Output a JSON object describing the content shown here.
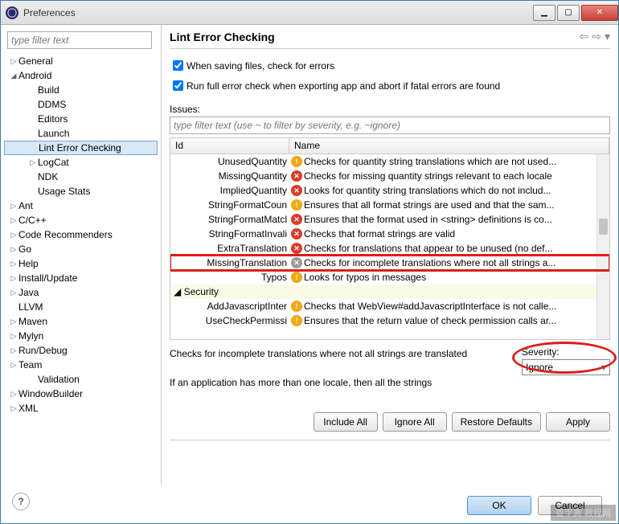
{
  "window": {
    "title": "Preferences"
  },
  "sidebar": {
    "filter_placeholder": "type filter text",
    "items": [
      {
        "label": "General",
        "depth": 1,
        "expand": "▷"
      },
      {
        "label": "Android",
        "depth": 1,
        "expand": "◢"
      },
      {
        "label": "Build",
        "depth": 2,
        "expand": ""
      },
      {
        "label": "DDMS",
        "depth": 2,
        "expand": ""
      },
      {
        "label": "Editors",
        "depth": 2,
        "expand": ""
      },
      {
        "label": "Launch",
        "depth": 2,
        "expand": ""
      },
      {
        "label": "Lint Error Checking",
        "depth": 2,
        "expand": "",
        "selected": true
      },
      {
        "label": "LogCat",
        "depth": 2,
        "expand": "▷"
      },
      {
        "label": "NDK",
        "depth": 2,
        "expand": ""
      },
      {
        "label": "Usage Stats",
        "depth": 2,
        "expand": ""
      },
      {
        "label": "Ant",
        "depth": 1,
        "expand": "▷"
      },
      {
        "label": "C/C++",
        "depth": 1,
        "expand": "▷"
      },
      {
        "label": "Code Recommenders",
        "depth": 1,
        "expand": "▷"
      },
      {
        "label": "Go",
        "depth": 1,
        "expand": "▷"
      },
      {
        "label": "Help",
        "depth": 1,
        "expand": "▷"
      },
      {
        "label": "Install/Update",
        "depth": 1,
        "expand": "▷"
      },
      {
        "label": "Java",
        "depth": 1,
        "expand": "▷"
      },
      {
        "label": "LLVM",
        "depth": 1,
        "expand": ""
      },
      {
        "label": "Maven",
        "depth": 1,
        "expand": "▷"
      },
      {
        "label": "Mylyn",
        "depth": 1,
        "expand": "▷"
      },
      {
        "label": "Run/Debug",
        "depth": 1,
        "expand": "▷"
      },
      {
        "label": "Team",
        "depth": 1,
        "expand": "▷"
      },
      {
        "label": "Validation",
        "depth": 2,
        "expand": ""
      },
      {
        "label": "WindowBuilder",
        "depth": 1,
        "expand": "▷"
      },
      {
        "label": "XML",
        "depth": 1,
        "expand": "▷"
      }
    ]
  },
  "main": {
    "heading": "Lint Error Checking",
    "chk1": "When saving files, check for errors",
    "chk2": "Run full error check when exporting app and abort if fatal errors are found",
    "issues_label": "Issues:",
    "issues_filter_placeholder": "type filter text (use ~ to filter by severity, e.g. ~ignore)",
    "col_id": "Id",
    "col_name": "Name",
    "rows": [
      {
        "id": "UnusedQuantity",
        "sev": "warn",
        "name": "Checks for quantity string translations which are not used..."
      },
      {
        "id": "MissingQuantity",
        "sev": "err",
        "name": "Checks for missing quantity strings relevant to each locale"
      },
      {
        "id": "ImpliedQuantity",
        "sev": "err",
        "name": "Looks for quantity string translations which do not includ..."
      },
      {
        "id": "StringFormatCoun",
        "sev": "warn",
        "name": "Ensures that all format strings are used and that the sam..."
      },
      {
        "id": "StringFormatMatcl",
        "sev": "err",
        "name": "Ensures that the format used in <string> definitions is co..."
      },
      {
        "id": "StringFormatInvali",
        "sev": "err",
        "name": "Checks that format strings are valid"
      },
      {
        "id": "ExtraTranslation",
        "sev": "err",
        "name": "Checks for translations that appear to be unused (no def..."
      },
      {
        "id": "MissingTranslation",
        "sev": "ign",
        "name": "Checks for incomplete translations where not all strings a...",
        "highlight": true
      },
      {
        "id": "Typos",
        "sev": "warn",
        "name": "Looks for typos in messages"
      },
      {
        "cat": true,
        "id": "◢ Security"
      },
      {
        "id": "AddJavascriptInter",
        "sev": "warn",
        "name": "Checks that WebView#addJavascriptInterface is not calle..."
      },
      {
        "id": "UseCheckPermissi",
        "sev": "warn",
        "name": "Ensures that the return value of check permission calls ar..."
      }
    ],
    "desc_line1": "Checks for incomplete translations where not all strings are translated",
    "desc_line2": "If an application has more than one locale, then all the strings",
    "severity_label": "Severity:",
    "severity_value": "Ignore",
    "btn_include": "Include All",
    "btn_ignore": "Ignore All",
    "btn_restore": "Restore Defaults",
    "btn_apply": "Apply",
    "btn_ok": "OK",
    "btn_cancel": "Cancel"
  },
  "watermark": "查字典 教程网"
}
